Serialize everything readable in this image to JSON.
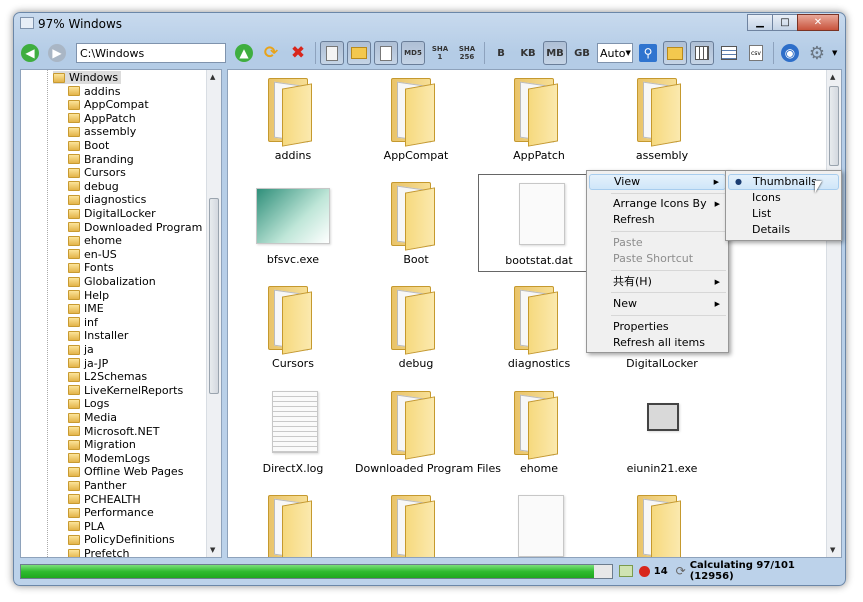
{
  "window": {
    "title": "97% Windows"
  },
  "toolbar": {
    "address": "C:\\Windows",
    "hash_md5": "MD5",
    "hash_sha1_a": "SHA",
    "hash_sha1_b": "1",
    "hash_sha256_a": "SHA",
    "hash_sha256_b": "256",
    "unit_b": "B",
    "unit_kb": "KB",
    "unit_mb": "MB",
    "unit_gb": "GB",
    "size_mode": "Auto",
    "csv_label": "csv"
  },
  "tree": {
    "items": [
      "Windows",
      "addins",
      "AppCompat",
      "AppPatch",
      "assembly",
      "Boot",
      "Branding",
      "Cursors",
      "debug",
      "diagnostics",
      "DigitalLocker",
      "Downloaded Program Files",
      "ehome",
      "en-US",
      "Fonts",
      "Globalization",
      "Help",
      "IME",
      "inf",
      "Installer",
      "ja",
      "ja-JP",
      "L2Schemas",
      "LiveKernelReports",
      "Logs",
      "Media",
      "Microsoft.NET",
      "Migration",
      "ModemLogs",
      "Offline Web Pages",
      "Panther",
      "PCHEALTH",
      "Performance",
      "PLA",
      "PolicyDefinitions",
      "Prefetch"
    ]
  },
  "content": {
    "items": [
      "addins",
      "AppCompat",
      "AppPatch",
      "assembly",
      "bfsvc.exe",
      "Boot",
      "bootstat.dat",
      "",
      "Cursors",
      "debug",
      "diagnostics",
      "DigitalLocker",
      "DirectX.log",
      "Downloaded Program Files",
      "ehome",
      "eiunin21.exe"
    ]
  },
  "context_menu": {
    "view": "View",
    "arrange": "Arrange Icons By",
    "refresh": "Refresh",
    "paste": "Paste",
    "paste_shortcut": "Paste Shortcut",
    "share": "共有(H)",
    "new": "New",
    "properties": "Properties",
    "refresh_all": "Refresh all items"
  },
  "submenu": {
    "thumbnails": "Thumbnails",
    "icons": "Icons",
    "list": "List",
    "details": "Details"
  },
  "status": {
    "progress_percent": 97,
    "error_count": "14",
    "text": "Calculating 97/101 (12956)"
  },
  "colors": {
    "progress": "#2fbb2f",
    "accent": "#1f6fd1"
  }
}
